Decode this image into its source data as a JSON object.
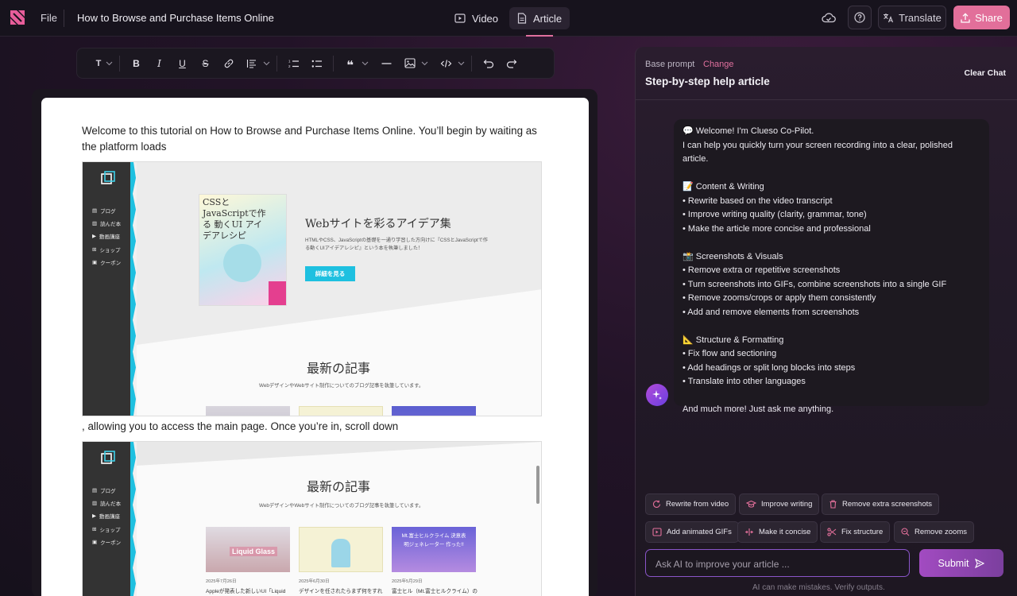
{
  "header": {
    "file": "File",
    "title": "How to Browse and Purchase Items Online",
    "tabs": [
      {
        "label": "Video"
      },
      {
        "label": "Article"
      }
    ],
    "translate": "Translate",
    "share": "Share"
  },
  "toolbar": {
    "text_style": "T"
  },
  "article": {
    "para1": "Welcome to this tutorial on How to Browse and Purchase Items Online. You’ll begin by waiting as the platform loads",
    "para2": ", allowing you to access the main page. Once you’re in, scroll down",
    "shot1": {
      "nav": [
        "ブログ",
        "読んだ本",
        "動画講座",
        "ショップ",
        "クーポン"
      ],
      "book_title": "CSSとJavaScriptで作る 動くUI アイデアレシピ",
      "hero_title": "Webサイトを彩るアイデア集",
      "hero_desc": "HTMLやCSS、JavaScriptの基礎を一通り学習した方向けに『CSSとJavaScriptで作る動くUIアイデアレシピ』という本を執筆しました！",
      "hero_button": "詳細を見る",
      "section_title": "最新の記事",
      "section_desc": "WebデザインやWebサイト制作についてのブログ記事を執筆しています。"
    },
    "shot2": {
      "nav": [
        "ブログ",
        "読んだ本",
        "動画講座",
        "ショップ",
        "クーポン"
      ],
      "section_title": "最新の記事",
      "section_desc": "WebデザインやWebサイト制作についてのブログ記事を執筆しています。",
      "cards": [
        {
          "thumb": "Liquid Glass",
          "date": "2025年7月26日",
          "title": "Appleが発表した新しいUI「Liquid"
        },
        {
          "thumb": "",
          "date": "2025年6月30日",
          "title": "デザインを任されたらまず何をすれ"
        },
        {
          "thumb": "Mt.富士ヒルクライム 決意表明ジェネレーター 作った!!",
          "date": "2025年5月29日",
          "title": "富士ヒル（Mt.富士ヒルクライム）の"
        }
      ]
    }
  },
  "assistant": {
    "base_prompt_label": "Base prompt",
    "change": "Change",
    "prompt_title": "Step-by-step help article",
    "clear_chat": "Clear Chat",
    "message": [
      "💬 Welcome! I'm Clueso Co-Pilot.",
      "I can help you quickly turn your screen recording into a clear, polished article.",
      "",
      "📝 Content & Writing",
      "• Rewrite based on the video transcript",
      "• Improve writing quality (clarity, grammar, tone)",
      "• Make the article more concise and professional",
      "",
      "📸 Screenshots & Visuals",
      "• Remove extra or repetitive screenshots",
      "• Turn screenshots into GIFs, combine screenshots into a single GIF",
      "• Remove zooms/crops or apply them consistently",
      "• Add and remove elements from screenshots",
      "",
      "📐 Structure & Formatting",
      "• Fix flow and sectioning",
      "• Add headings or split long blocks into steps",
      "• Translate into other languages",
      "",
      "And much more! Just ask me anything."
    ],
    "chips": [
      {
        "label": "Rewrite from video",
        "icon": "refresh-icon"
      },
      {
        "label": "Improve writing",
        "icon": "graduation-cap-icon"
      },
      {
        "label": "Remove extra screenshots",
        "icon": "trash-icon"
      },
      {
        "label": "Add animated GIFs",
        "icon": "gif-icon"
      },
      {
        "label": "Make it concise",
        "icon": "compress-icon"
      },
      {
        "label": "Fix structure",
        "icon": "scissors-icon"
      },
      {
        "label": "Remove zooms",
        "icon": "zoom-out-icon"
      }
    ],
    "input_placeholder": "Ask AI to improve your article ...",
    "submit": "Submit",
    "disclaimer": "AI can make mistakes. Verify outputs."
  }
}
